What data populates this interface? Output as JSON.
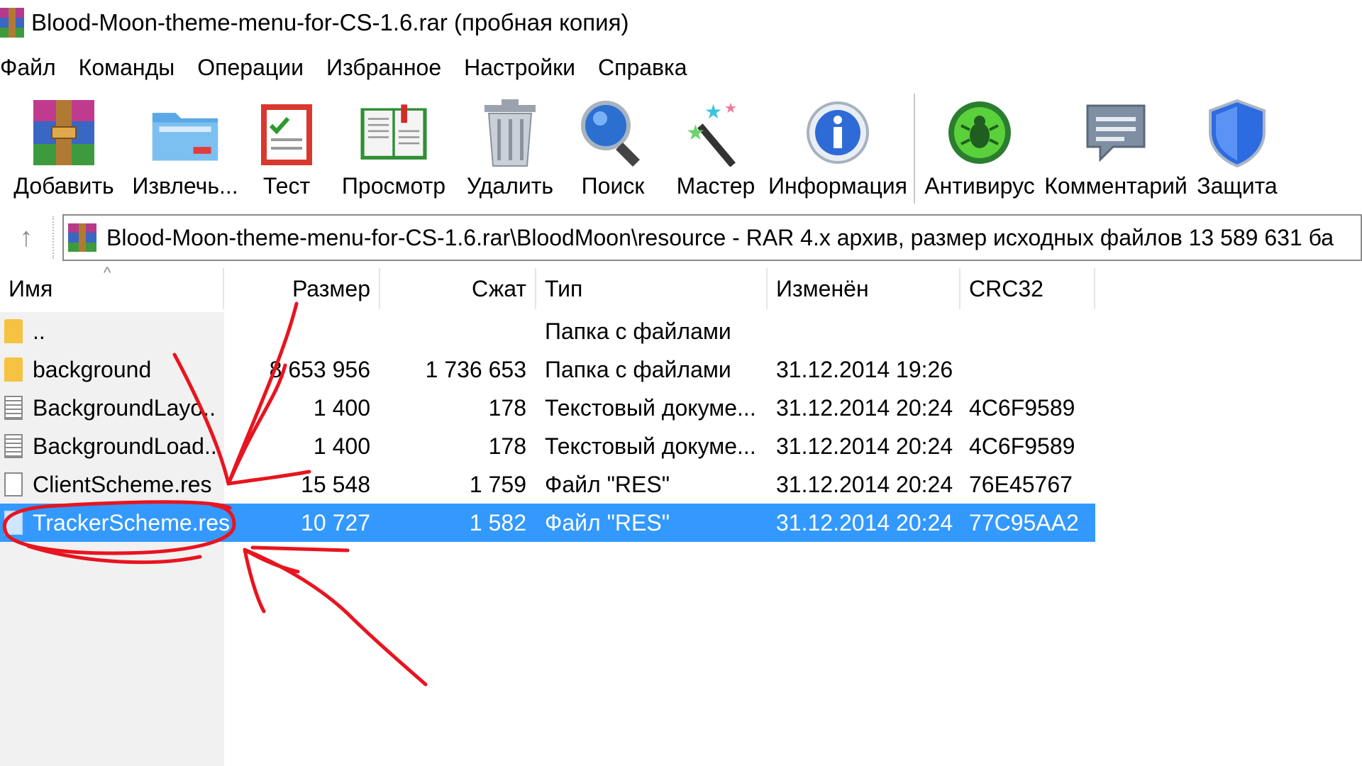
{
  "window": {
    "title": "Blood-Moon-theme-menu-for-CS-1.6.rar (пробная копия)"
  },
  "menu": [
    "Файл",
    "Команды",
    "Операции",
    "Избранное",
    "Настройки",
    "Справка"
  ],
  "toolbar": [
    {
      "label": "Добавить",
      "icon": "add-archive-icon"
    },
    {
      "label": "Извлечь...",
      "icon": "extract-folder-icon"
    },
    {
      "label": "Тест",
      "icon": "test-checklist-icon"
    },
    {
      "label": "Просмотр",
      "icon": "view-book-icon"
    },
    {
      "label": "Удалить",
      "icon": "trash-icon"
    },
    {
      "label": "Поиск",
      "icon": "magnifier-icon"
    },
    {
      "label": "Мастер",
      "icon": "wizard-wand-icon"
    },
    {
      "label": "Информация",
      "icon": "info-icon"
    },
    {
      "label": "Антивирус",
      "icon": "antivirus-bug-icon"
    },
    {
      "label": "Комментарий",
      "icon": "comment-icon"
    },
    {
      "label": "Защита",
      "icon": "shield-icon"
    }
  ],
  "address": {
    "path": "Blood-Moon-theme-menu-for-CS-1.6.rar\\BloodMoon\\resource - RAR 4.x архив, размер исходных файлов 13 589 631 ба"
  },
  "columns": [
    "Имя",
    "Размер",
    "Сжат",
    "Тип",
    "Изменён",
    "CRC32"
  ],
  "files": [
    {
      "name": "..",
      "size": "",
      "packed": "",
      "type": "Папка с файлами",
      "modified": "",
      "crc": "",
      "icon": "folder"
    },
    {
      "name": "background",
      "size": "8 653 956",
      "packed": "1 736 653",
      "type": "Папка с файлами",
      "modified": "31.12.2014 19:26",
      "crc": "",
      "icon": "folder"
    },
    {
      "name": "BackgroundLayo...",
      "size": "1 400",
      "packed": "178",
      "type": "Текстовый докуме...",
      "modified": "31.12.2014 20:24",
      "crc": "4C6F9589",
      "icon": "text"
    },
    {
      "name": "BackgroundLoad...",
      "size": "1 400",
      "packed": "178",
      "type": "Текстовый докуме...",
      "modified": "31.12.2014 20:24",
      "crc": "4C6F9589",
      "icon": "text"
    },
    {
      "name": "ClientScheme.res",
      "size": "15 548",
      "packed": "1 759",
      "type": "Файл \"RES\"",
      "modified": "31.12.2014 20:24",
      "crc": "76E45767",
      "icon": "file"
    },
    {
      "name": "TrackerScheme.res",
      "size": "10 727",
      "packed": "1 582",
      "type": "Файл \"RES\"",
      "modified": "31.12.2014 20:24",
      "crc": "77C95AA2",
      "icon": "file",
      "selected": true
    }
  ],
  "colors": {
    "selection": "#3399ff",
    "annotation": "#e8141f",
    "folder": "#f5c242"
  }
}
